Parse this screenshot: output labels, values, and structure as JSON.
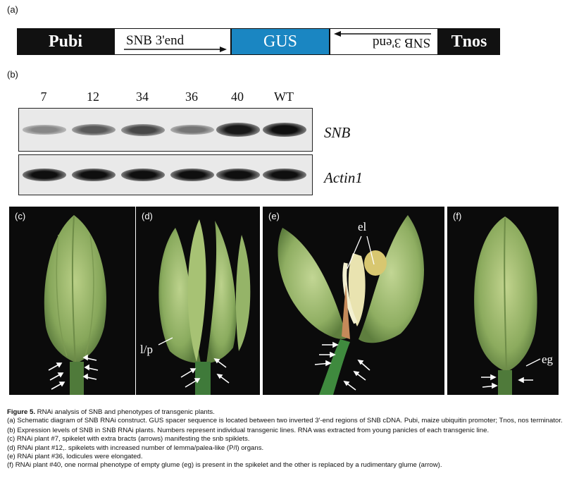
{
  "panel_a": {
    "label": "(a)",
    "pubi": "Pubi",
    "snb_forward": "SNB  3'end",
    "gus": "GUS",
    "snb_reverse": "SNB  3'end",
    "tnos": "Tnos"
  },
  "panel_b": {
    "label": "(b)",
    "lanes": [
      "7",
      "12",
      "34",
      "36",
      "40",
      "WT"
    ],
    "blots": [
      {
        "gene": "SNB",
        "band_intensity": [
          0.35,
          0.6,
          0.7,
          0.45,
          0.95,
          1.0
        ]
      },
      {
        "gene": "Actin1",
        "band_intensity": [
          1.0,
          1.0,
          1.0,
          1.0,
          1.0,
          1.0
        ]
      }
    ]
  },
  "photos": {
    "c": {
      "label": "(c)"
    },
    "d": {
      "label": "(d)",
      "annotation": "l/p"
    },
    "e": {
      "label": "(e)",
      "annotation": "el"
    },
    "f": {
      "label": "(f)",
      "annotation": "eg"
    }
  },
  "caption": {
    "title_bold": "Figure 5.",
    "title_rest": "  RNAi  analysis of SNB and phenotypes of transgenic plants.",
    "a": "(a) Schematic diagram of SNB RNAi construct. GUS spacer sequence is located between two inverted 3′-end regions of SNB cDNA. Pubi, maize ubiquitin promoter; Tnos, nos terminator.",
    "b": "(b) Expression levels of SNB in SNB RNAi plants. Numbers represent individual transgenic lines. RNA was extracted from young panicles of each transgenic line.",
    "c": "(c) RNAi plant #7, spikelet with extra bracts (arrows) manifesting the snb spiklets.",
    "d": "(d) RNAi plant #12,. spikelets with increased number of lemma/palea-like (P/l) organs.",
    "e": "(e) RNAi plant #36, lodicules were elongated.",
    "f": "(f) RNAi plant #40, one normal phenotype of empty glume (eg) is present in the spikelet and the other is replaced by a rudimentary glume (arrow)."
  },
  "colors": {
    "gus": "#1a86c2",
    "photo_bg": "#0b0b0b",
    "spikelet_green": "#9bb86a"
  }
}
